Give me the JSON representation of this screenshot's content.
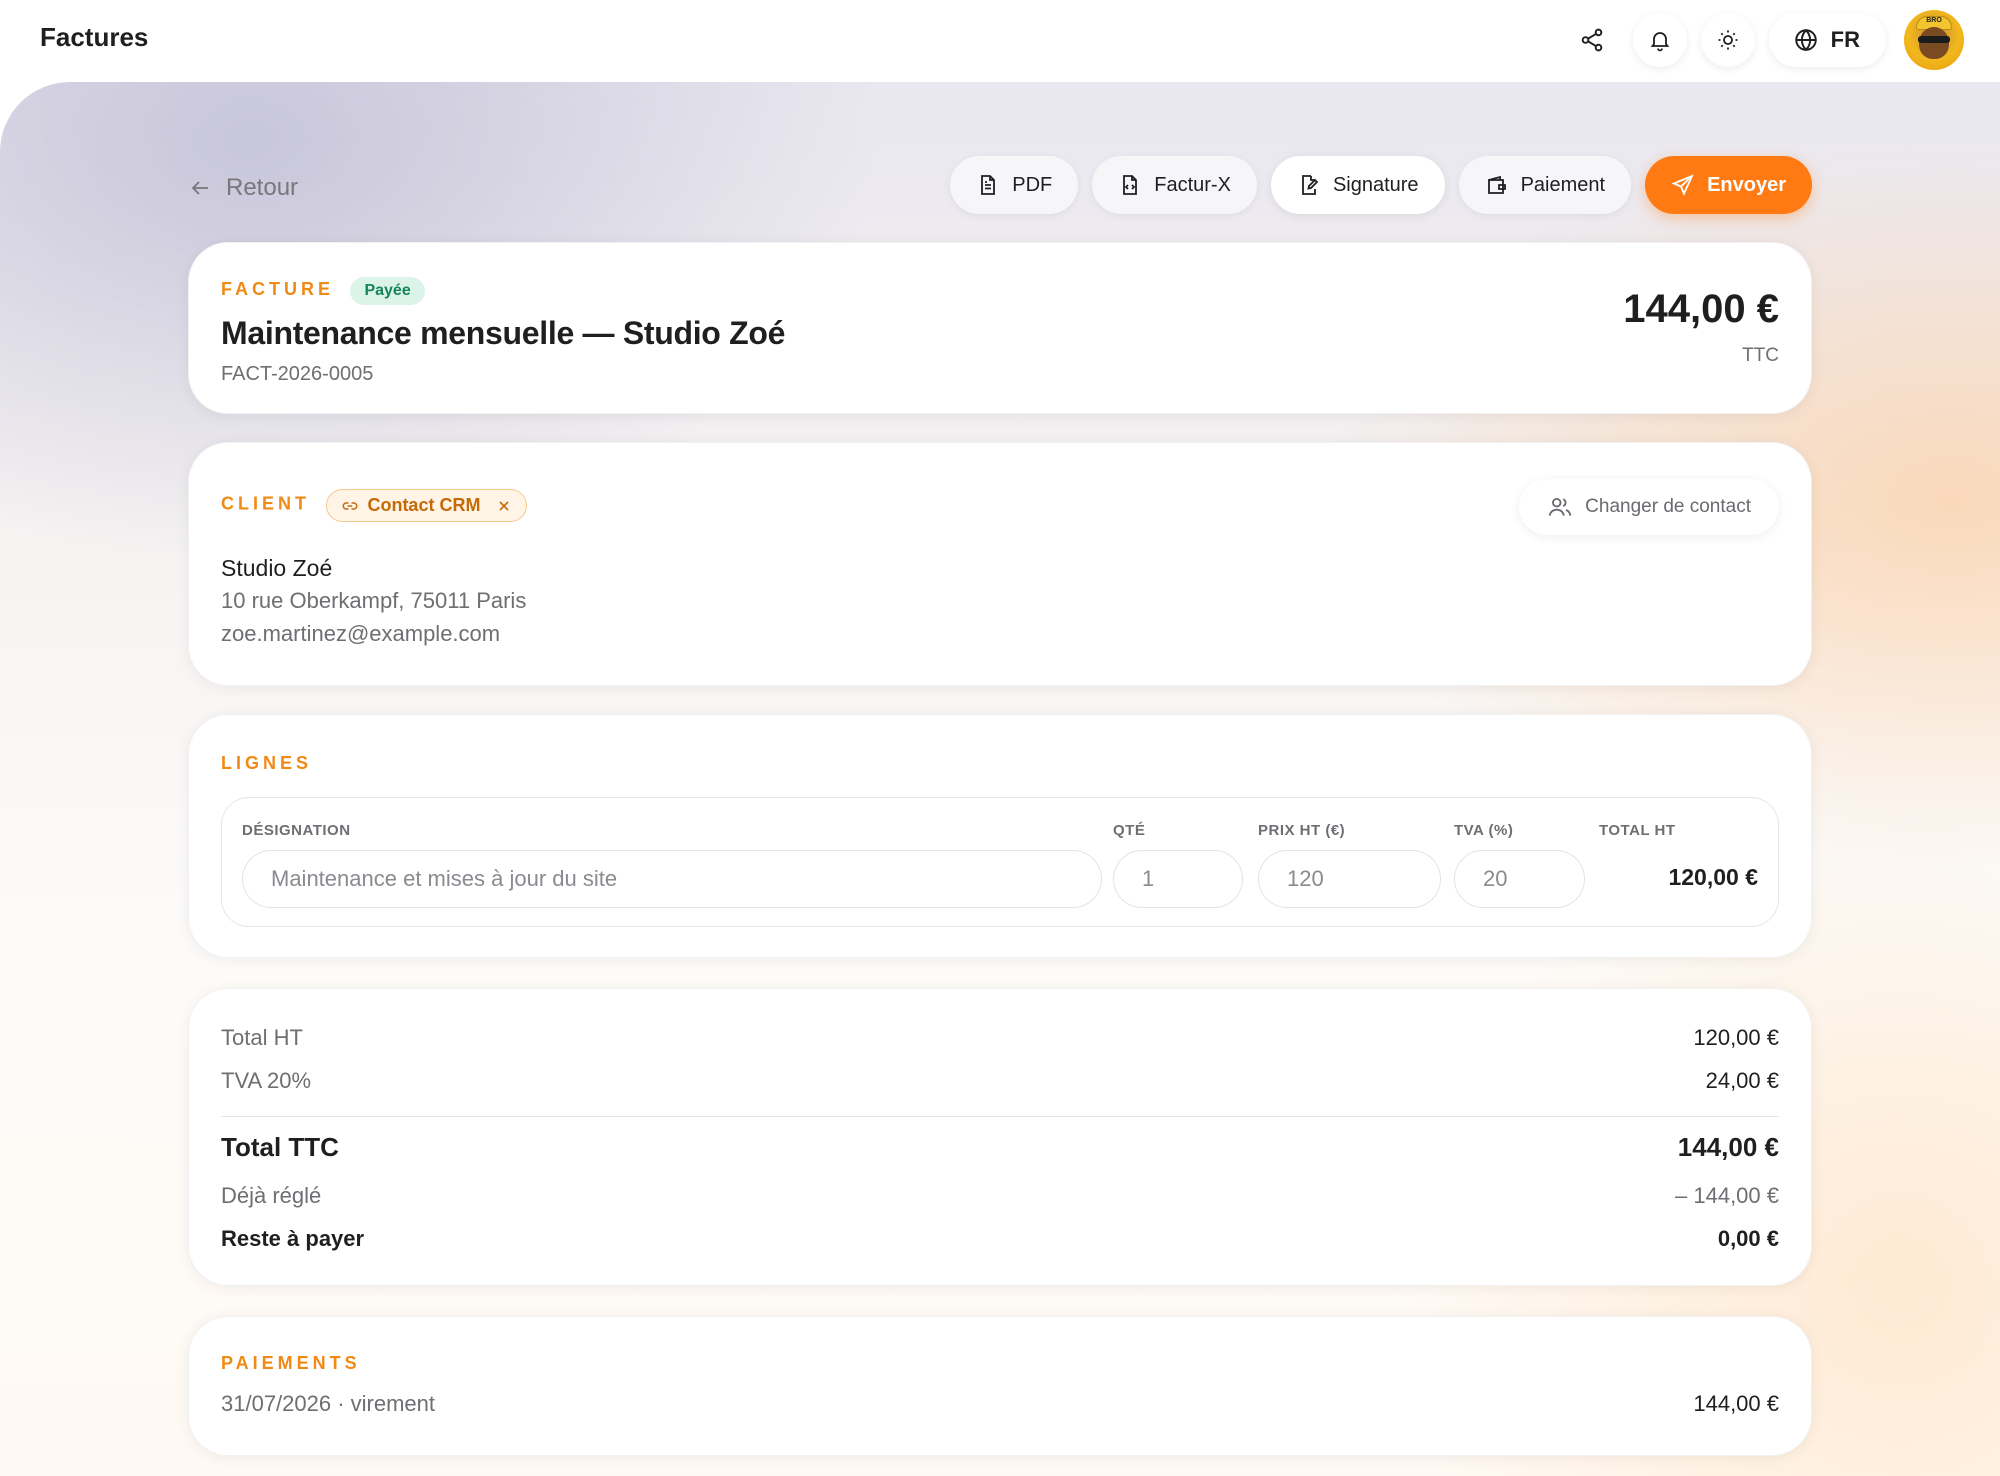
{
  "app": {
    "title": "Factures"
  },
  "topbar": {
    "language": "FR",
    "avatar_text": "BRO"
  },
  "nav": {
    "back_label": "Retour"
  },
  "toolbar": {
    "pdf_label": "PDF",
    "facturx_label": "Factur-X",
    "signature_label": "Signature",
    "payment_label": "Paiement",
    "send_label": "Envoyer"
  },
  "invoice": {
    "eyebrow": "FACTURE",
    "status": "Payée",
    "title": "Maintenance mensuelle — Studio Zoé",
    "number": "FACT-2026-0005",
    "amount": "144,00 €",
    "amount_suffix": "TTC"
  },
  "client": {
    "eyebrow": "CLIENT",
    "crm_chip": "Contact CRM",
    "change_label": "Changer de contact",
    "name": "Studio Zoé",
    "address": "10 rue Oberkampf, 75011 Paris",
    "email": "zoe.martinez@example.com"
  },
  "lines": {
    "eyebrow": "LIGNES",
    "headers": {
      "designation": "DÉSIGNATION",
      "qty": "QTÉ",
      "price": "PRIX HT (€)",
      "vat": "TVA (%)",
      "total": "TOTAL HT"
    },
    "items": [
      {
        "designation": "Maintenance et mises à jour du site",
        "qty": "1",
        "price": "120",
        "vat": "20",
        "total": "120,00 €"
      }
    ]
  },
  "totals": {
    "ht_label": "Total HT",
    "ht_value": "120,00 €",
    "vat_label": "TVA 20%",
    "vat_value": "24,00 €",
    "ttc_label": "Total TTC",
    "ttc_value": "144,00 €",
    "paid_label": "Déjà réglé",
    "paid_value": "– 144,00 €",
    "due_label": "Reste à payer",
    "due_value": "0,00 €"
  },
  "payments": {
    "eyebrow": "PAIEMENTS",
    "items": [
      {
        "label": "31/07/2026 · virement",
        "amount": "144,00 €"
      }
    ]
  },
  "colors": {
    "accent": "#ff7a12",
    "eyebrow": "#f08a14",
    "paid_bg": "#dcf3ea",
    "paid_text": "#16855a"
  }
}
